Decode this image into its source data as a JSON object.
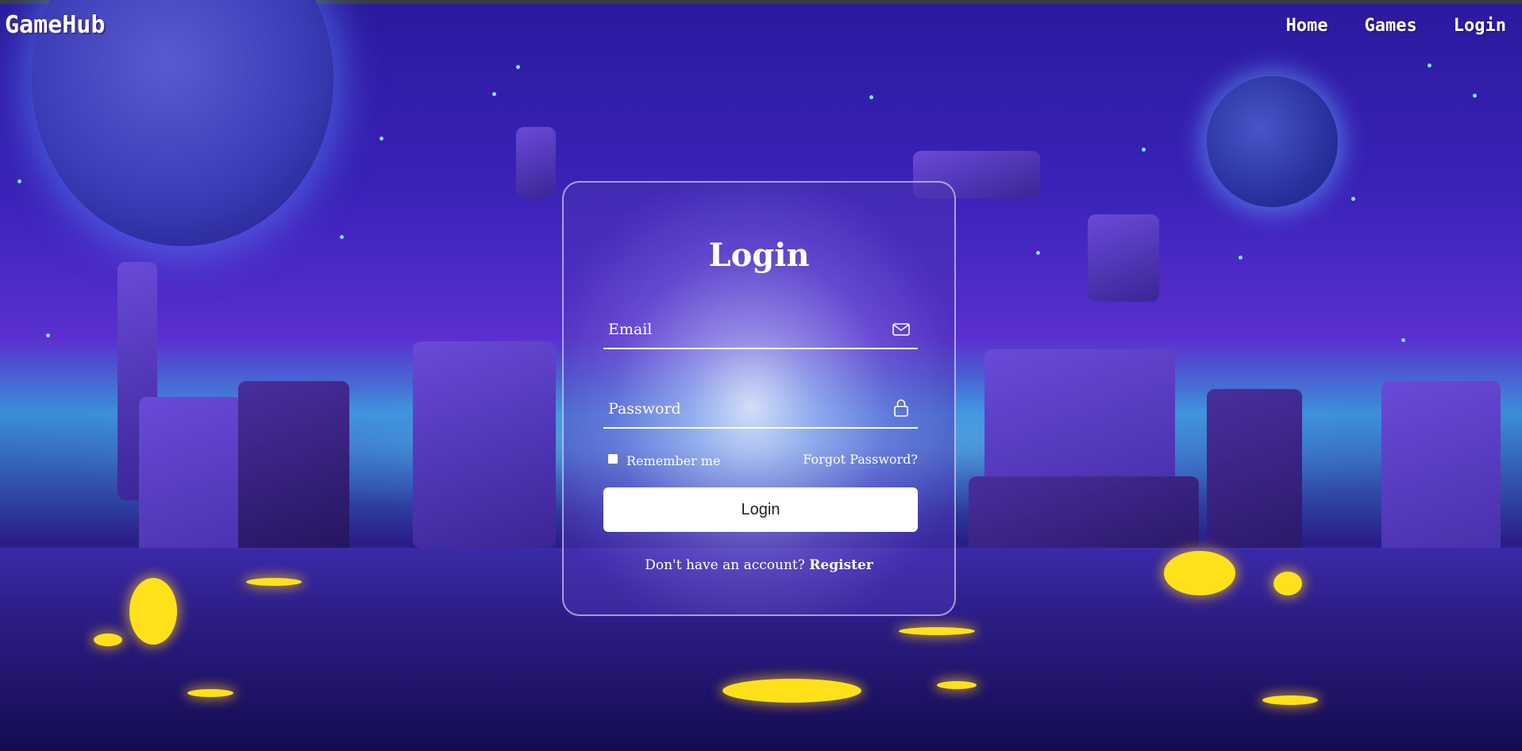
{
  "brand": "GameHub",
  "nav": {
    "home": "Home",
    "games": "Games",
    "login": "Login"
  },
  "card": {
    "title": "Login",
    "email_placeholder": "Email",
    "email_icon": "envelope-icon",
    "password_placeholder": "Password",
    "password_icon": "lock-icon",
    "remember_label": "Remember me",
    "remember_checked": false,
    "forgot_label": "Forgot Password?",
    "login_button": "Login",
    "no_account_text": "Don't have an account?",
    "register_link": "Register"
  },
  "colors": {
    "accent": "#ffffff",
    "background_top": "#2a1a9e",
    "lava": "#ffe11a"
  }
}
